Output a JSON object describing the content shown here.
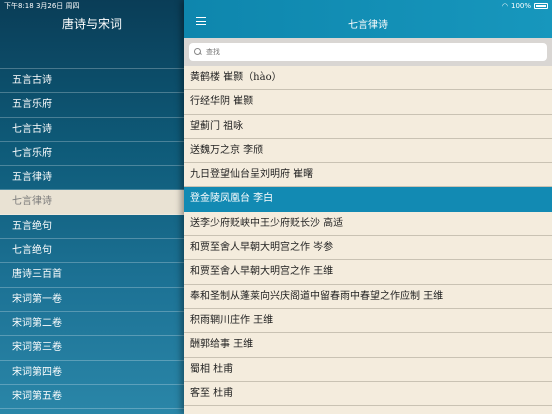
{
  "status": {
    "time_date": "下午8:18  3月26日 周四",
    "battery": "100%"
  },
  "sidebar": {
    "title": "唐诗与宋词",
    "items": [
      {
        "label": "五言古诗"
      },
      {
        "label": "五言乐府"
      },
      {
        "label": "七言古诗"
      },
      {
        "label": "七言乐府"
      },
      {
        "label": "五言律诗"
      },
      {
        "label": "七言律诗"
      },
      {
        "label": "五言绝句"
      },
      {
        "label": "七言绝句"
      },
      {
        "label": "唐诗三百首"
      },
      {
        "label": "宋词第一卷"
      },
      {
        "label": "宋词第二卷"
      },
      {
        "label": "宋词第三卷"
      },
      {
        "label": "宋词第四卷"
      },
      {
        "label": "宋词第五卷"
      }
    ],
    "active_index": 5
  },
  "header": {
    "title": "七言律诗"
  },
  "search": {
    "placeholder": "查找"
  },
  "poems": [
    {
      "label": "黄鹤楼 崔颢（hào）"
    },
    {
      "label": "行经华阴 崔颢"
    },
    {
      "label": "望蓟门 祖咏"
    },
    {
      "label": "送魏万之京 李颀"
    },
    {
      "label": "九日登望仙台呈刘明府 崔曙"
    },
    {
      "label": "登金陵凤凰台 李白"
    },
    {
      "label": "送李少府贬峡中王少府贬长沙 高适"
    },
    {
      "label": "和贾至舍人早朝大明宫之作 岑参"
    },
    {
      "label": "和贾至舍人早朝大明宫之作 王维"
    },
    {
      "label": "奉和圣制从蓬莱向兴庆阁道中留春雨中春望之作应制 王维"
    },
    {
      "label": "积雨辋川庄作 王维"
    },
    {
      "label": "酬郭给事 王维"
    },
    {
      "label": "蜀相 杜甫"
    },
    {
      "label": "客至 杜甫"
    }
  ],
  "poems_active_index": 5
}
